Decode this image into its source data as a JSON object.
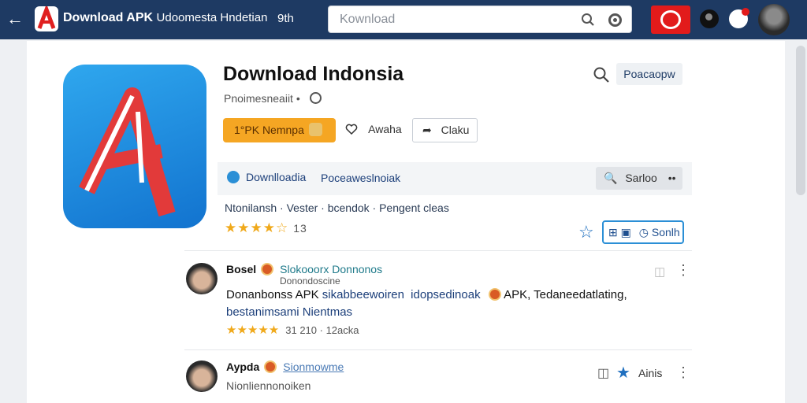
{
  "header": {
    "brand": "Download APK",
    "brand_sub": "Udoomesta Hndetian",
    "version": "9th",
    "search_placeholder": "Kownload"
  },
  "app": {
    "title": "Download Indonsia",
    "subtitle": "Pnoimesneaiit •",
    "popular_label": "Poacaopw",
    "install_label": "1°PK Nemnpa",
    "wishlist_label": "Awaha",
    "share_label": "Claku"
  },
  "tabs": {
    "download": "Downlloadia",
    "perm": "Poceaweslnoiak",
    "sort_label": "Sarloo"
  },
  "meta": {
    "line": "Ntonilansh · Vester · bcendok · Pengent cleas",
    "rating_count": "13",
    "rating_value": 4.5,
    "follow_label": "Sonlh"
  },
  "reviews": [
    {
      "name": "Bosel",
      "tag": "Slokooorx Donnonos",
      "sub": "Donondoscine",
      "text_a": "Donanbonss APK",
      "text_b": "sikabbeewoiren",
      "text_c": "idopsedinoak",
      "text_d": "APK, Tedaneedatlating,",
      "text_e": "bestanimsami Nientmas",
      "stars": "★★★★★",
      "meta": "31 210 ·   12acka"
    },
    {
      "name": "Aypda",
      "tag": "Sionmowme",
      "sub": "Nionliennonoiken",
      "action": "Ainis"
    }
  ]
}
